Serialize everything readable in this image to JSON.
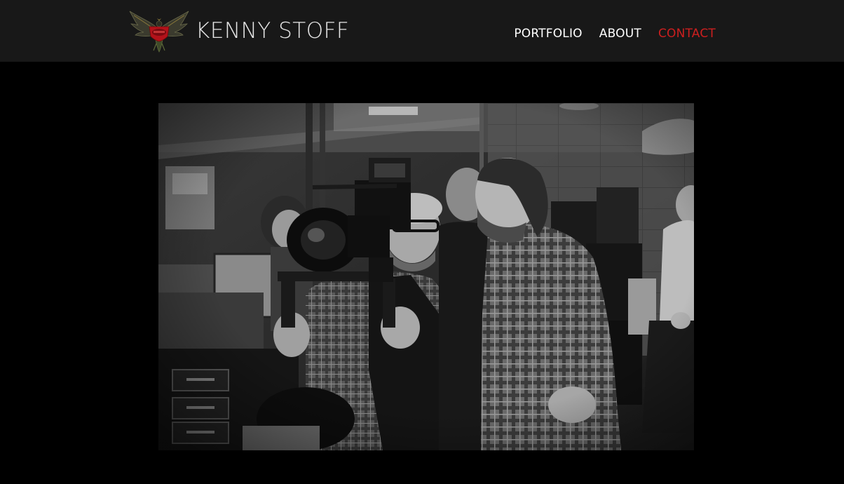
{
  "site": {
    "title": "KENNY STOFF",
    "logo_icon": "winged-eagle-emblem-icon",
    "colors": {
      "header_bg": "#181818",
      "accent": "#cc1f1f",
      "page_bg": "#000000"
    }
  },
  "nav": {
    "items": [
      {
        "label": "PORTFOLIO",
        "active": false
      },
      {
        "label": "ABOUT",
        "active": false
      },
      {
        "label": "CONTACT",
        "active": true
      }
    ]
  },
  "main": {
    "photo_alt": "Black and white backstage photo of a camera operator filming with a cinema rig while onlookers watch"
  }
}
